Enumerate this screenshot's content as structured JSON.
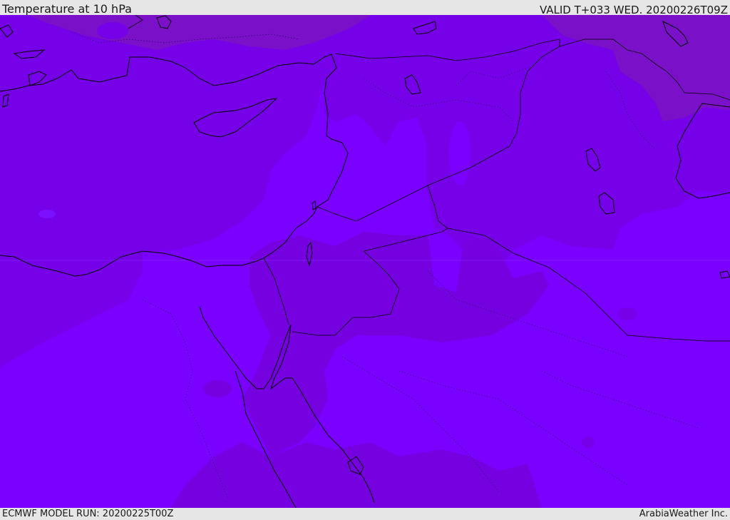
{
  "header": {
    "title": "Temperature at 10 hPa",
    "valid": "VALID T+033 WED. 20200226T09Z"
  },
  "footer": {
    "model_run": "ECMWF MODEL RUN: 20200225T00Z",
    "credit": "ArabiaWeather Inc."
  },
  "colors": {
    "field_light": "#7a00ff",
    "field_mid": "#7700e6",
    "field_dark": "#7a10c8",
    "coastline": "#000000",
    "bar_background": "#e6e6e6"
  }
}
